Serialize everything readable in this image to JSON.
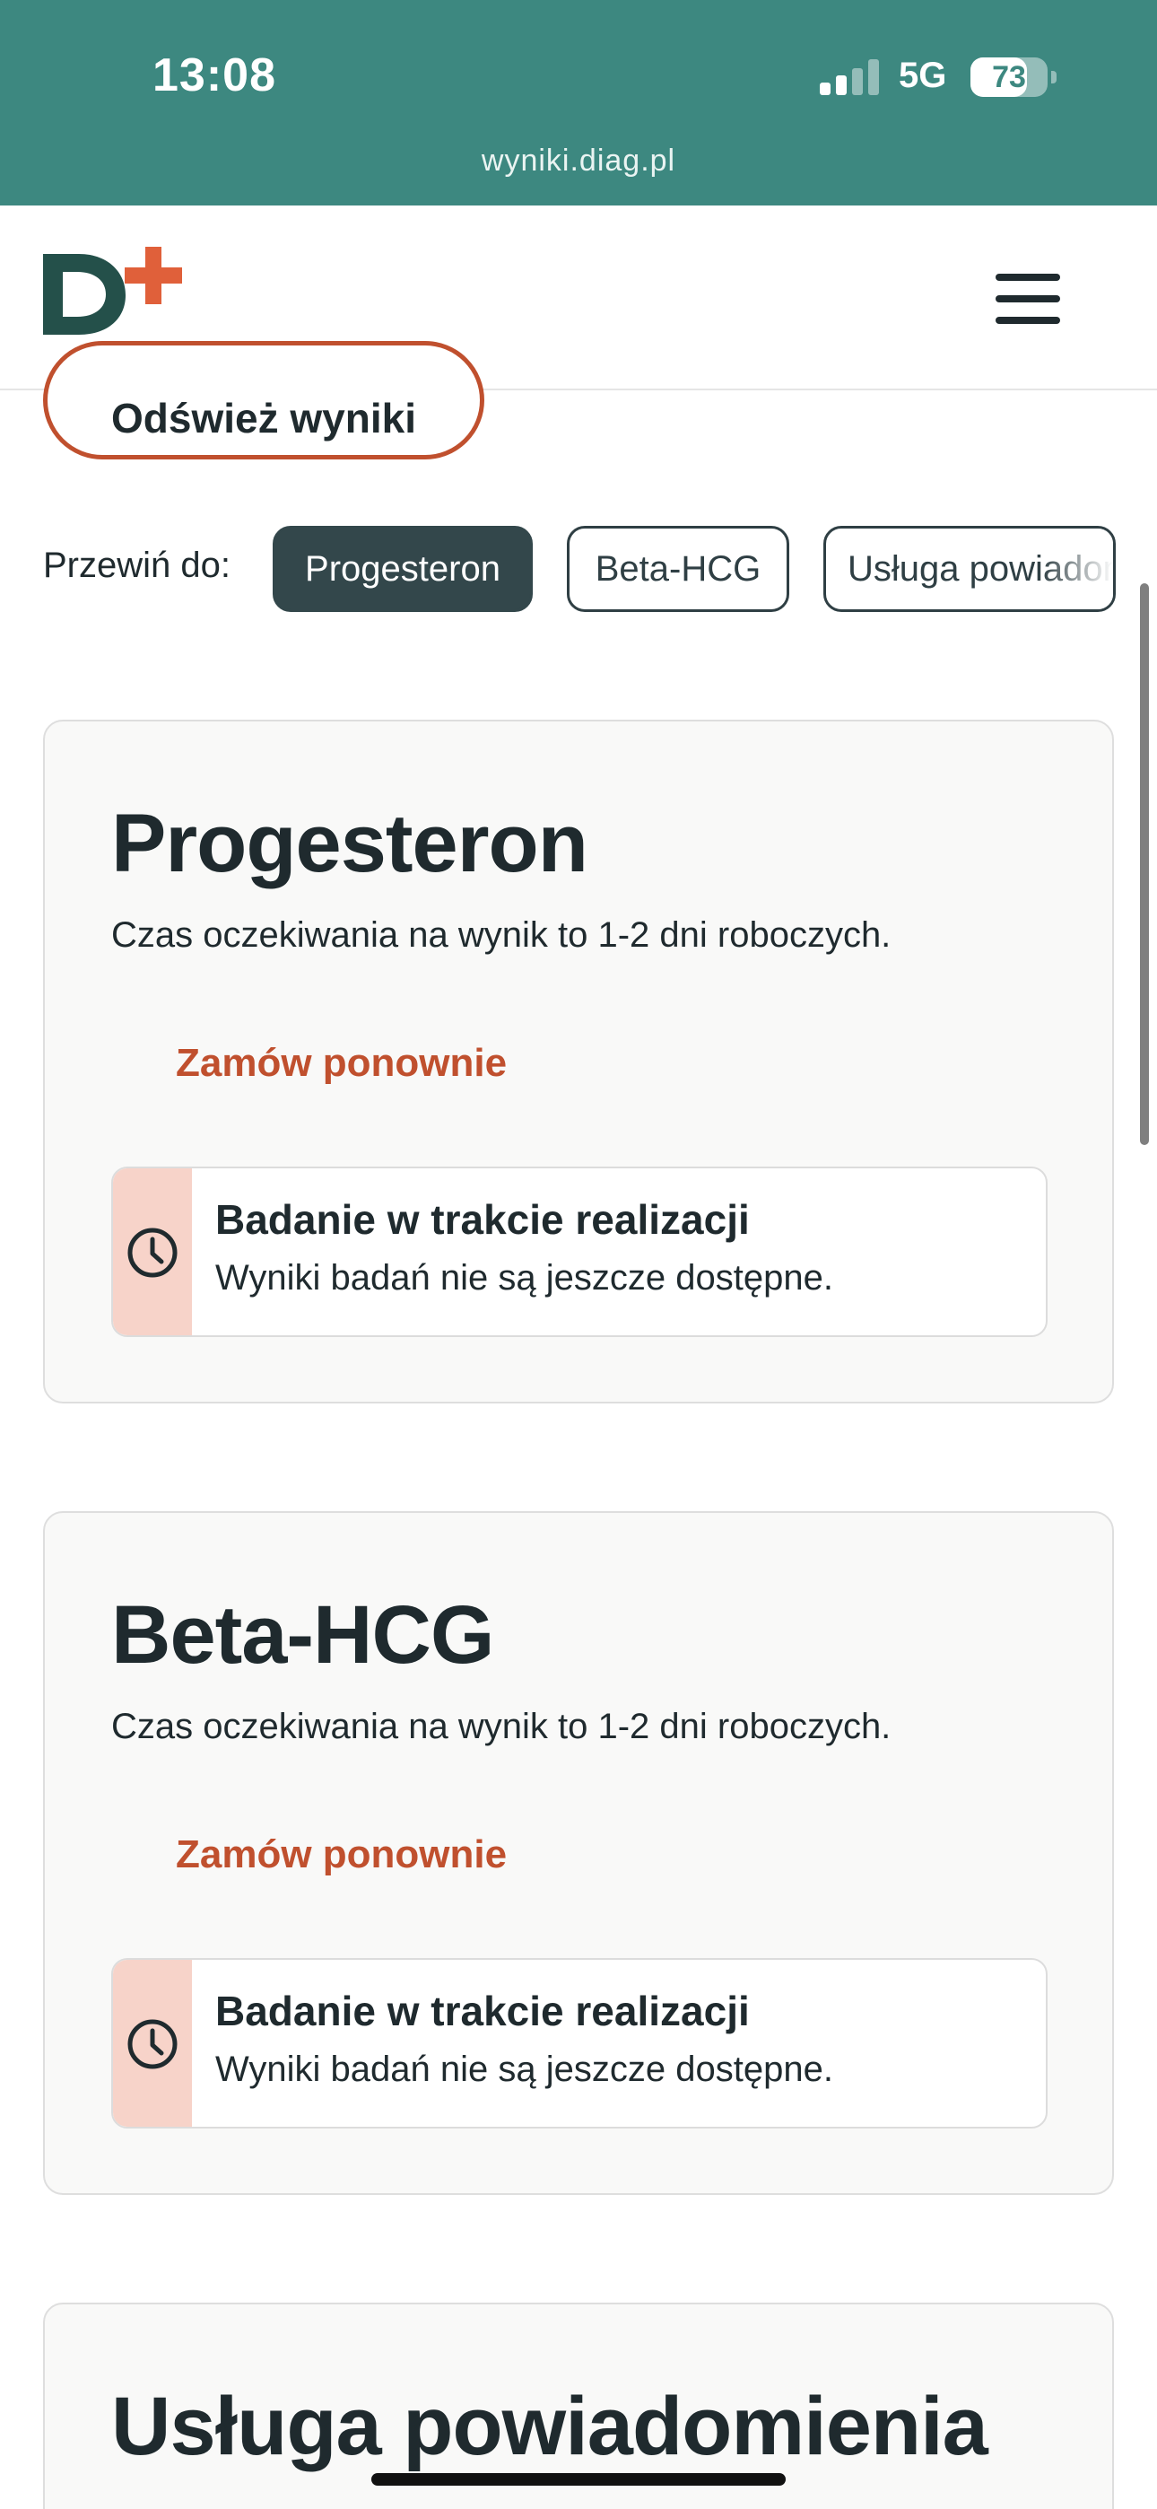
{
  "status_bar": {
    "time": "13:08",
    "network": "5G",
    "battery_percent": "73",
    "battery_level": 0.73,
    "signal_bars_active": 2,
    "signal_bars_total": 4
  },
  "browser": {
    "url": "wyniki.diag.pl"
  },
  "header": {
    "logo_icon": "diagnostyka-d-plus-logo",
    "menu_icon": "hamburger-menu-icon"
  },
  "refresh_button": {
    "label": "Odśwież wyniki"
  },
  "jump_to": {
    "label": "Przewiń do:",
    "chips": [
      {
        "label": "Progesteron",
        "active": true
      },
      {
        "label": "Beta-HCG",
        "active": false
      },
      {
        "label": "Usługa powiadomienia",
        "active": false
      }
    ]
  },
  "cards": [
    {
      "title": "Progesteron",
      "subtitle": "Czas oczekiwania na wynik to 1-2 dni roboczych.",
      "reorder_label": "Zamów ponownie",
      "status_title": "Badanie w trakcie realizacji",
      "status_text": "Wyniki badań nie są jeszcze dostępne.",
      "status_icon": "clock-icon"
    },
    {
      "title": "Beta-HCG",
      "subtitle": "Czas oczekiwania na wynik to 1-2 dni roboczych.",
      "reorder_label": "Zamów ponownie",
      "status_title": "Badanie w trakcie realizacji",
      "status_text": "Wyniki badań nie są jeszcze dostępne.",
      "status_icon": "clock-icon"
    },
    {
      "title": "Usługa powiadomienia"
    }
  ],
  "colors": {
    "browser_bar": "#3d8880",
    "accent": "#c0502e",
    "dark": "#1f2a2e",
    "status_stripe": "#f7d3c9"
  }
}
